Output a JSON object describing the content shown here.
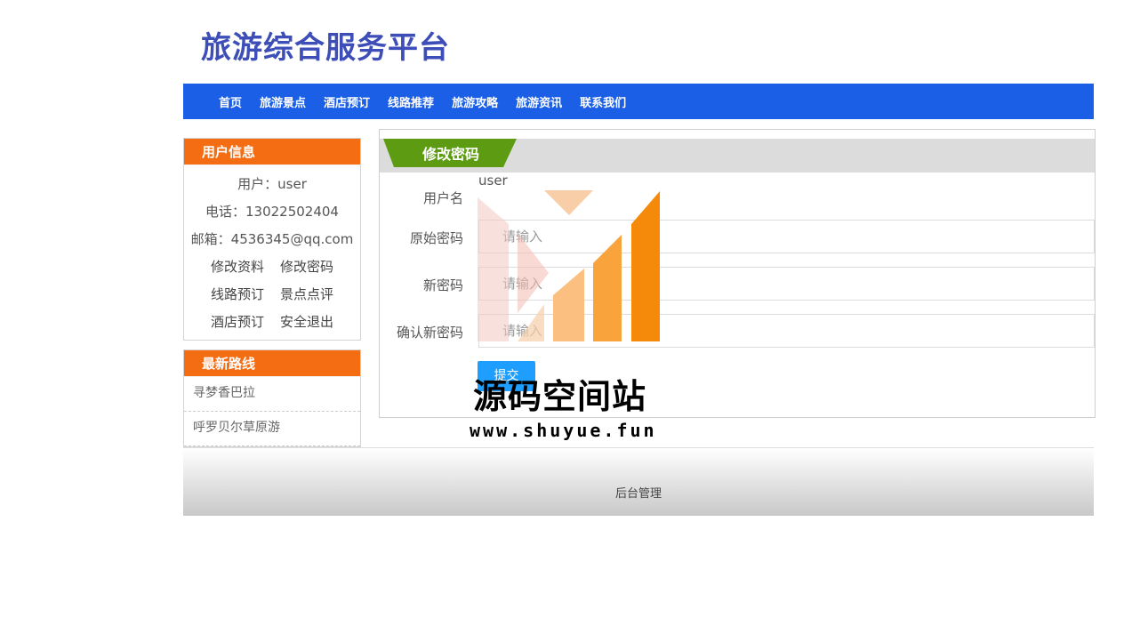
{
  "site": {
    "title": "旅游综合服务平台"
  },
  "nav": [
    "首页",
    "旅游景点",
    "酒店预订",
    "线路推荐",
    "旅游攻略",
    "旅游资讯",
    "联系我们"
  ],
  "user_panel": {
    "title": "用户信息",
    "user": "用户：user",
    "phone": "电话：13022502404",
    "email": "邮箱：4536345@qq.com",
    "links": [
      [
        "修改资料",
        "修改密码"
      ],
      [
        "线路预订",
        "景点点评"
      ],
      [
        "酒店预订",
        "安全退出"
      ]
    ]
  },
  "route_panel": {
    "title": "最新路线",
    "items": [
      "寻梦香巴拉",
      "呼罗贝尔草原游"
    ]
  },
  "form": {
    "tab_title": "修改密码",
    "username_label": "用户名",
    "username_value": "user",
    "old_label": "原始密码",
    "old_placeholder": "请输入",
    "new_label": "新密码",
    "new_placeholder": "请输入",
    "confirm_label": "确认新密码",
    "confirm_placeholder": "请输入",
    "submit": "提交"
  },
  "watermark": {
    "name": "源码空间站",
    "url": "www.shuyue.fun"
  },
  "footer": {
    "link": "后台管理"
  },
  "colors": {
    "nav": "#1a5fe6",
    "panel_head": "#f46d12",
    "tab": "#5d9c12",
    "title": "#3e4eb8"
  }
}
